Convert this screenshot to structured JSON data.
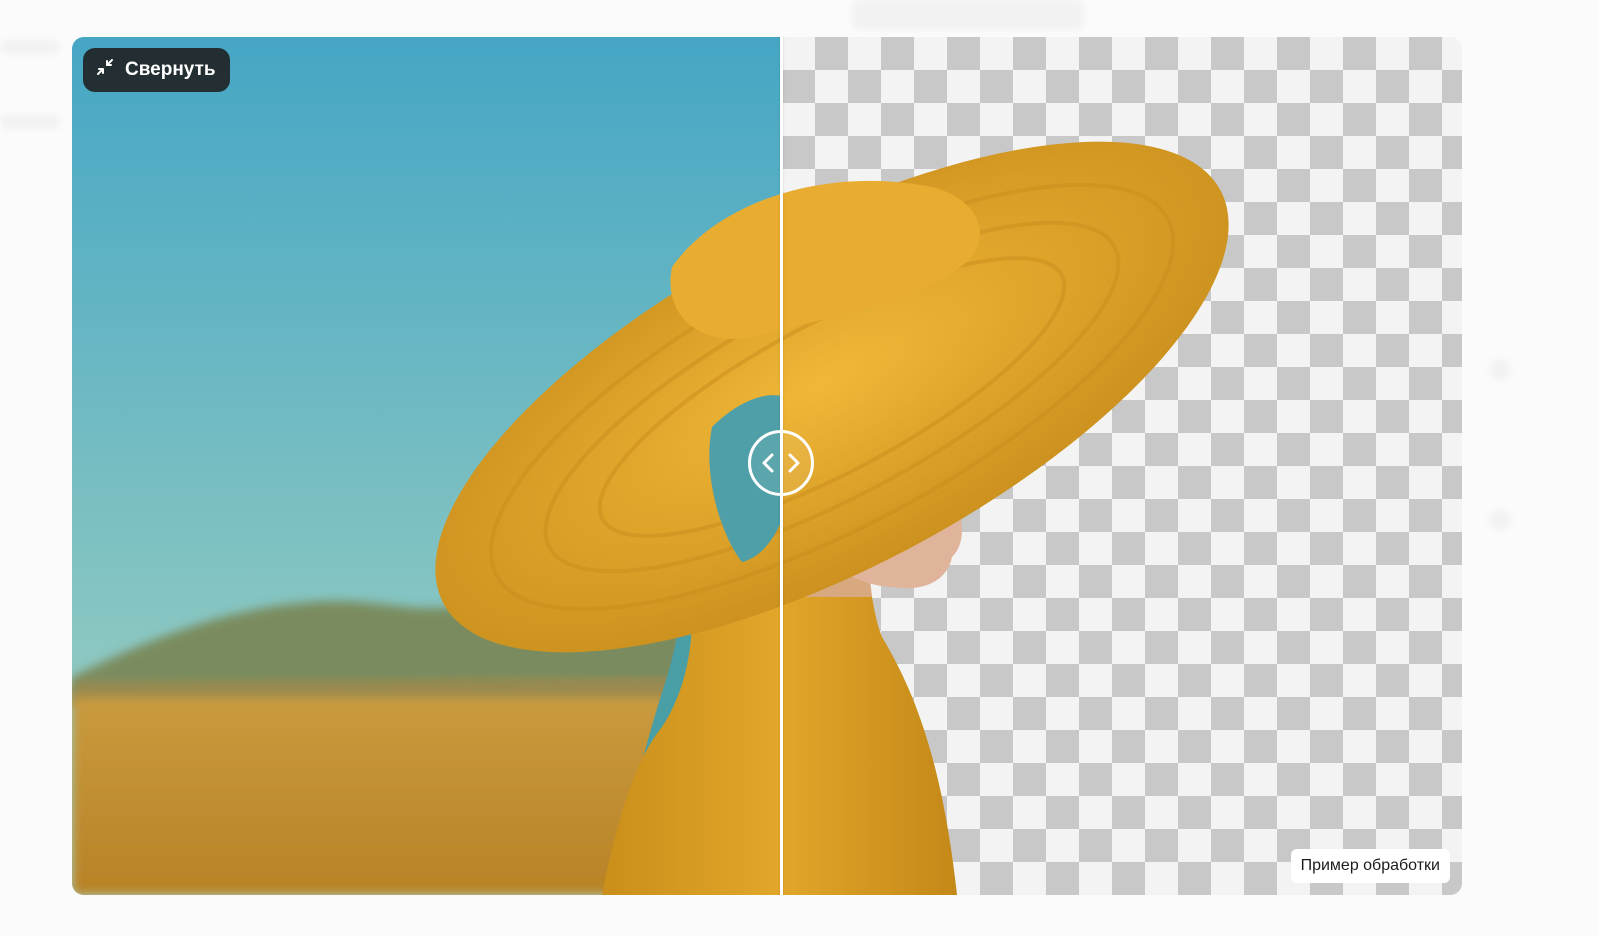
{
  "viewer": {
    "collapse_button": {
      "label": "Свернуть",
      "icon": "collapse-arrows-icon"
    },
    "badge": "Пример обработки",
    "comparison": {
      "before": "original photo with background",
      "after": "background removed (transparent)",
      "slider_position": 0.51
    },
    "handle": {
      "left_icon": "chevron-left-icon",
      "right_icon": "chevron-right-icon"
    }
  },
  "colors": {
    "sky_top": "#4aa9c6",
    "sky_bottom": "#8ec8c6",
    "hat": "#e3a52a",
    "scarf": "#4a9ea6",
    "dress": "#d99b1c",
    "field": "#c9952f",
    "checker_dark": "#c8c8c8",
    "checker_light": "#f3f3f3",
    "button_bg": "#1e1e1e"
  }
}
